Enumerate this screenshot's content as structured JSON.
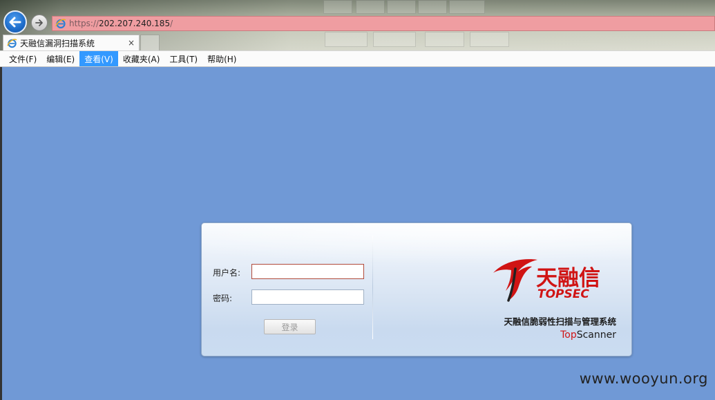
{
  "browser": {
    "address": {
      "protocol": "https://",
      "host": "202.207.240.185",
      "path": "/"
    },
    "tab": {
      "title": "天融信漏洞扫描系统",
      "close_glyph": "×"
    },
    "icons": {
      "back": "back-arrow-icon",
      "forward": "forward-arrow-icon",
      "site": "ie-icon"
    }
  },
  "menubar": {
    "items": [
      {
        "label": "文件(F)"
      },
      {
        "label": "编辑(E)"
      },
      {
        "label": "查看(V)",
        "active": true
      },
      {
        "label": "收藏夹(A)"
      },
      {
        "label": "工具(T)"
      },
      {
        "label": "帮助(H)"
      }
    ]
  },
  "login": {
    "username_label": "用户名:",
    "username_value": "",
    "password_label": "密码:",
    "password_value": "",
    "submit_label": "登录"
  },
  "brand": {
    "logo_cn": "天融信",
    "logo_en": "TOPSEC",
    "product_name": "天融信脆弱性扫描与管理系统",
    "product_en_prefix": "Top",
    "product_en_suffix": "Scanner",
    "accent_color": "#d01414"
  },
  "watermark": "www.wooyun.org",
  "colors": {
    "page_background": "#7099d6",
    "address_bar": "#ef9da1",
    "menu_active": "#3399ff"
  }
}
